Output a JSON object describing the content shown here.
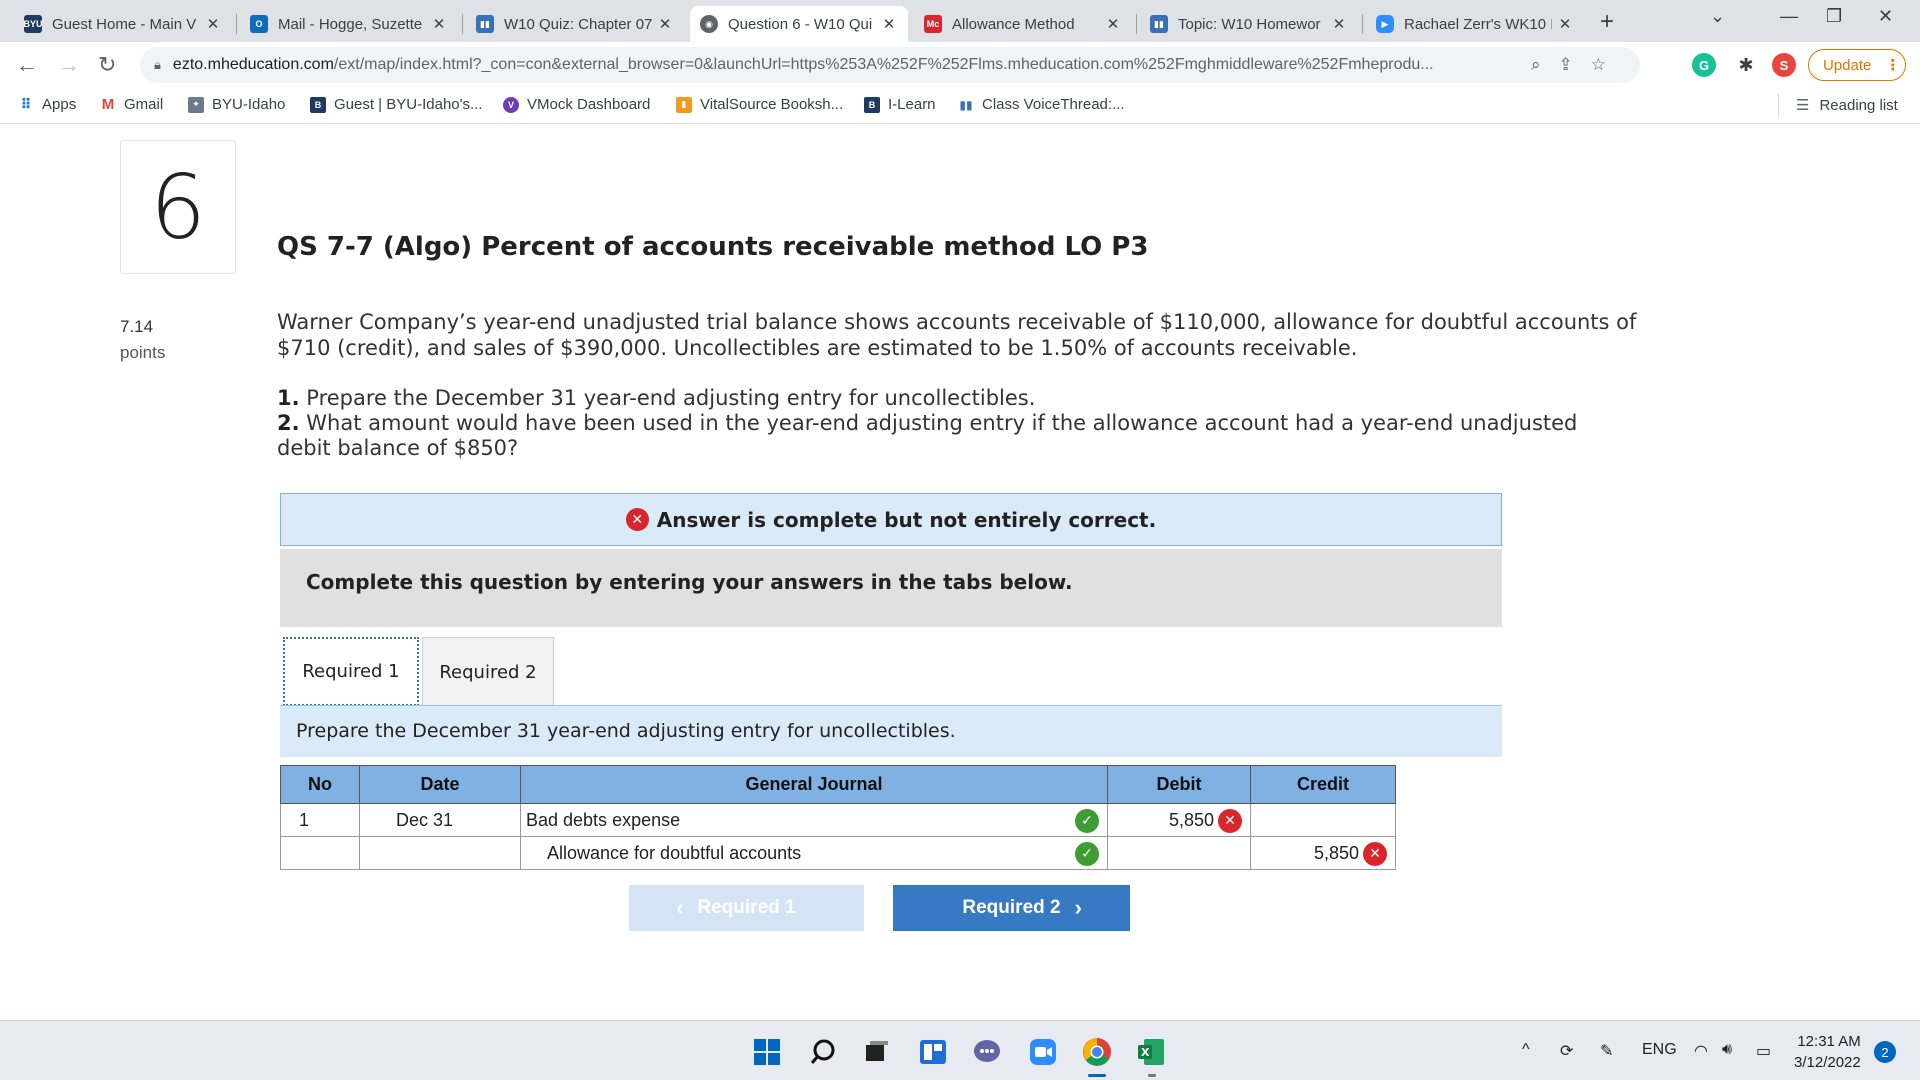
{
  "browser": {
    "tabs": [
      {
        "title": "Guest Home - Main V",
        "icon": "byu-icon",
        "color": "#1f3a60"
      },
      {
        "title": "Mail - Hogge, Suzette",
        "icon": "outlook-icon",
        "color": "#0f6cbd"
      },
      {
        "title": "W10 Quiz: Chapter 07",
        "icon": "voicethread-icon",
        "color": "#3b6fb6"
      },
      {
        "title": "Question 6 - W10 Qui",
        "icon": "globe-icon",
        "color": "#5f6368",
        "active": true
      },
      {
        "title": "Allowance Method",
        "icon": "mcgraw-hill-icon",
        "color": "#d9262c"
      },
      {
        "title": "Topic: W10 Homewor",
        "icon": "voicethread-icon",
        "color": "#3b6fb6"
      },
      {
        "title": "Rachael Zerr's WK10 I",
        "icon": "zoom-icon",
        "color": "#2d8cff"
      }
    ],
    "url_host": "ezto.mheducation.com",
    "url_path": "/ext/map/index.html?_con=con&external_browser=0&launchUrl=https%253A%252F%252Flms.mheducation.com%252Fmghmiddleware%252Fmheprodu...",
    "update_label": "Update",
    "profile_initial": "S",
    "bookmarks": [
      {
        "label": "Apps",
        "icon": "apps-grid-icon"
      },
      {
        "label": "Gmail",
        "icon": "gmail-icon"
      },
      {
        "label": "BYU-Idaho",
        "icon": "byu-idaho-icon"
      },
      {
        "label": "Guest | BYU-Idaho's...",
        "icon": "byu-icon"
      },
      {
        "label": "VMock Dashboard",
        "icon": "vmock-icon"
      },
      {
        "label": "VitalSource Booksh...",
        "icon": "vitalsource-icon"
      },
      {
        "label": "I-Learn",
        "icon": "byu-icon"
      },
      {
        "label": "Class VoiceThread:...",
        "icon": "voicethread-icon"
      }
    ],
    "reading_list": "Reading list"
  },
  "question": {
    "number": "6",
    "title": "QS 7-7 (Algo) Percent of accounts receivable method LO P3",
    "points_value": "7.14",
    "points_label": "points",
    "prompt": "Warner Company’s year-end unadjusted trial balance shows accounts receivable of $110,000, allowance for doubtful accounts of $710 (credit), and sales of $390,000. Uncollectibles are estimated to be 1.50% of accounts receivable.",
    "req1_num": "1.",
    "req1_text": "Prepare the December 31 year-end adjusting entry for uncollectibles.",
    "req2_num": "2.",
    "req2_text": "What amount would have been used in the year-end adjusting entry if the allowance account had a year-end unadjusted debit balance of $850?"
  },
  "feedback": {
    "status": "Answer is complete but not entirely correct.",
    "instructions": "Complete this question by entering your answers in the tabs below."
  },
  "tabs": {
    "req1": "Required 1",
    "req2": "Required 2",
    "subprompt": "Prepare the December 31 year-end adjusting entry for uncollectibles."
  },
  "journal": {
    "headers": {
      "no": "No",
      "date": "Date",
      "gj": "General Journal",
      "debit": "Debit",
      "credit": "Credit"
    },
    "rows": [
      {
        "no": "1",
        "date": "Dec 31",
        "account": "Bad debts expense",
        "account_correct": true,
        "debit": "5,850",
        "debit_correct": false,
        "credit": ""
      },
      {
        "no": "",
        "date": "",
        "account": "Allowance for doubtful accounts",
        "account_correct": true,
        "debit": "",
        "credit": "5,850",
        "credit_correct": false
      }
    ]
  },
  "nav": {
    "prev_label": "Required 1",
    "next_label": "Required 2"
  },
  "taskbar": {
    "language": "ENG",
    "time": "12:31 AM",
    "date": "3/12/2022",
    "notifications": "2"
  }
}
